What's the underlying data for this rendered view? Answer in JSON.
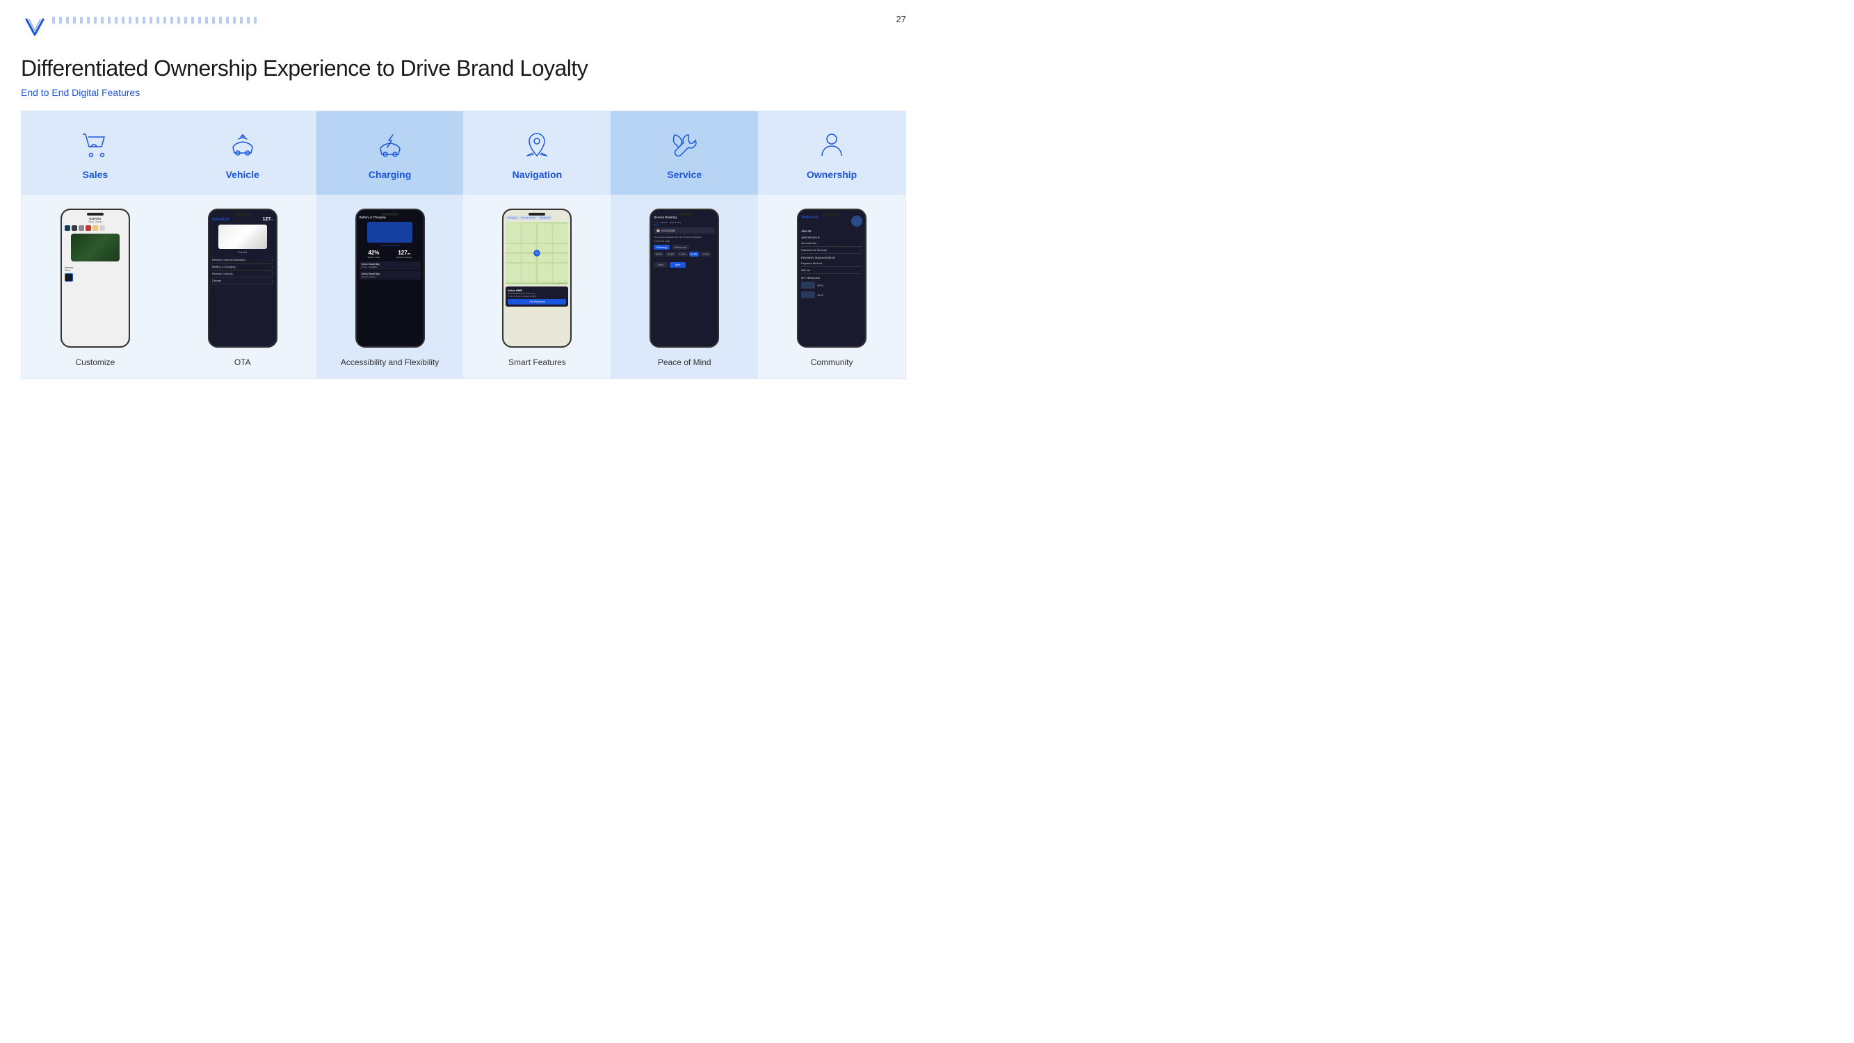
{
  "page": {
    "number": "27",
    "title": "Differentiated Ownership Experience to Drive Brand Loyalty",
    "subtitle": "End to End Digital Features"
  },
  "features": [
    {
      "id": "sales",
      "label": "Sales",
      "icon": "cart",
      "caption": "Customize",
      "highlight": false
    },
    {
      "id": "vehicle",
      "label": "Vehicle",
      "icon": "car-wifi",
      "caption": "OTA",
      "highlight": false
    },
    {
      "id": "charging",
      "label": "Charging",
      "icon": "car-charging",
      "caption": "Accessibility and Flexibility",
      "highlight": true
    },
    {
      "id": "navigation",
      "label": "Navigation",
      "icon": "map-pin",
      "caption": "Smart Features",
      "highlight": false
    },
    {
      "id": "service",
      "label": "Service",
      "icon": "wrench",
      "caption": "Peace of Mind",
      "highlight": true
    },
    {
      "id": "ownership",
      "label": "Ownership",
      "icon": "person",
      "caption": "Community",
      "highlight": false
    }
  ]
}
